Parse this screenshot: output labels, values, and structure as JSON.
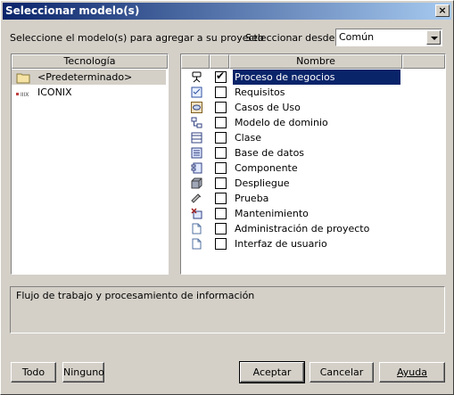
{
  "window": {
    "title": "Seleccionar modelo(s)",
    "close_label": "×"
  },
  "instruction": "Seleccione el modelo(s) para agregar a su proyecto",
  "select_from": {
    "label": "Seleccionar desde:",
    "value": "Común"
  },
  "technology": {
    "header": "Tecnología",
    "items": [
      {
        "label": "<Predeterminado>",
        "icon": "folder-icon",
        "selected": true
      },
      {
        "label": "ICONIX",
        "icon": "iconix-icon",
        "selected": false
      }
    ]
  },
  "models": {
    "header": "Nombre",
    "items": [
      {
        "label": "Proceso de negocios",
        "icon": "business-process-icon",
        "checked": true,
        "selected": true
      },
      {
        "label": "Requisitos",
        "icon": "requirements-icon",
        "checked": false,
        "selected": false
      },
      {
        "label": "Casos de Uso",
        "icon": "use-case-icon",
        "checked": false,
        "selected": false
      },
      {
        "label": "Modelo de dominio",
        "icon": "domain-model-icon",
        "checked": false,
        "selected": false
      },
      {
        "label": "Clase",
        "icon": "class-icon",
        "checked": false,
        "selected": false
      },
      {
        "label": "Base de datos",
        "icon": "database-icon",
        "checked": false,
        "selected": false
      },
      {
        "label": "Componente",
        "icon": "component-icon",
        "checked": false,
        "selected": false
      },
      {
        "label": "Despliegue",
        "icon": "deployment-icon",
        "checked": false,
        "selected": false
      },
      {
        "label": "Prueba",
        "icon": "test-icon",
        "checked": false,
        "selected": false
      },
      {
        "label": "Mantenimiento",
        "icon": "maintenance-icon",
        "checked": false,
        "selected": false
      },
      {
        "label": "Administración de proyecto",
        "icon": "document-icon",
        "checked": false,
        "selected": false
      },
      {
        "label": "Interfaz de usuario",
        "icon": "document-icon",
        "checked": false,
        "selected": false
      }
    ]
  },
  "description": "Flujo de trabajo y procesamiento de información",
  "buttons": {
    "all": "Todo",
    "none": "Ninguno",
    "ok": "Aceptar",
    "cancel": "Cancelar",
    "help": "Ayuda"
  },
  "colors": {
    "selection": "#0a246a",
    "face": "#d4d0c8",
    "title_start": "#0a246a",
    "title_end": "#a6caf0"
  }
}
